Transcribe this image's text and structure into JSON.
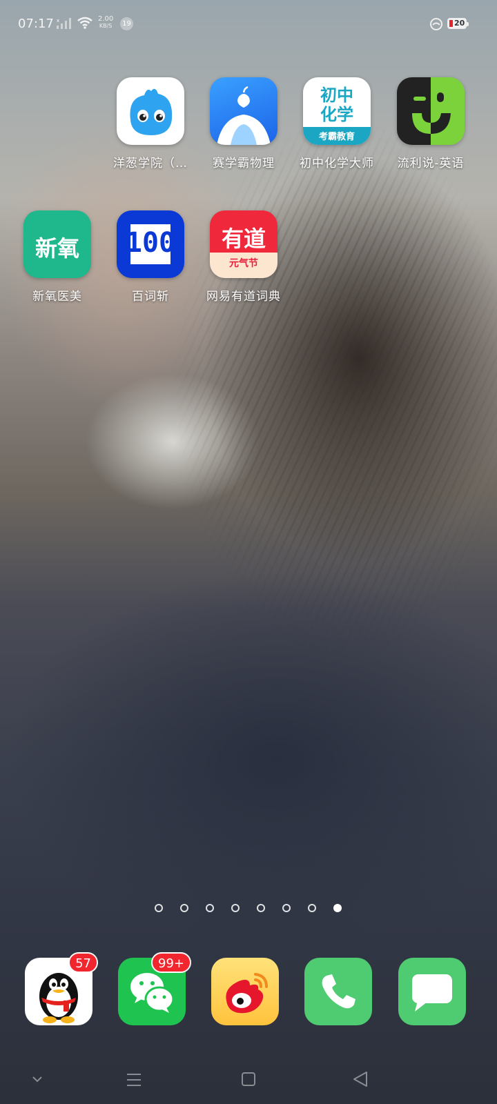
{
  "status_bar": {
    "time": "07:17",
    "net_speed_value": "2.00",
    "net_speed_unit": "KB/S",
    "notification_count": "19",
    "battery_level": "20",
    "battery_color": "#e4242a"
  },
  "apps": [
    {
      "label": "洋葱学院（…",
      "icon": "onion-mascot-icon"
    },
    {
      "label": "赛学霸物理",
      "icon": "physics-apple-icon"
    },
    {
      "label": "初中化学大师",
      "icon": "chemistry-icon",
      "icon_text_1": "初中",
      "icon_text_2": "化学",
      "icon_text_3": "考霸教育"
    },
    {
      "label": "流利说-英语",
      "icon": "smiley-face-icon"
    },
    {
      "label": "新氧医美",
      "icon": "soyoung-icon",
      "icon_text": "新氧"
    },
    {
      "label": "百词斩",
      "icon": "baicizhan-icon",
      "icon_text": "100"
    },
    {
      "label": "网易有道词典",
      "icon": "youdao-icon",
      "icon_text_1": "有道",
      "icon_text_2": "元气节"
    }
  ],
  "page_indicator": {
    "total": 8,
    "active_index": 7
  },
  "dock": [
    {
      "name": "QQ",
      "icon": "qq-penguin-icon",
      "badge": "57"
    },
    {
      "name": "WeChat",
      "icon": "wechat-icon",
      "badge": "99+"
    },
    {
      "name": "Weibo",
      "icon": "weibo-icon"
    },
    {
      "name": "Phone",
      "icon": "phone-icon"
    },
    {
      "name": "Messages",
      "icon": "message-icon"
    }
  ]
}
